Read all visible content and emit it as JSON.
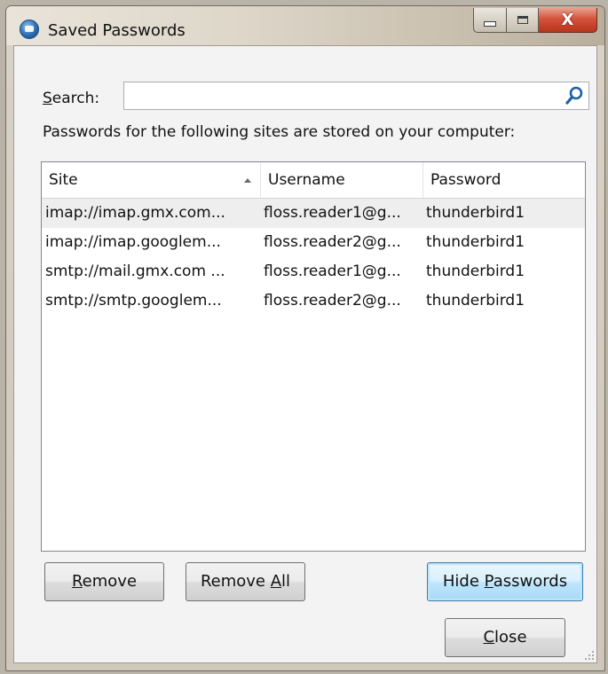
{
  "window": {
    "title": "Saved Passwords",
    "app_icon": "thunderbird-icon"
  },
  "caption_buttons": {
    "minimize": "minimize-icon",
    "maximize": "maximize-icon",
    "close_glyph": "X"
  },
  "search": {
    "label_prefix": "",
    "label_accesskey": "S",
    "label_rest": "earch:",
    "value": "",
    "placeholder": "",
    "icon": "search-icon"
  },
  "info_text": "Passwords for the following sites are stored on your computer:",
  "table": {
    "columns": {
      "site": "Site",
      "username": "Username",
      "password": "Password"
    },
    "sort_column": "Site",
    "rows": [
      {
        "site": "imap://imap.gmx.com...",
        "username": "floss.reader1@g...",
        "password": "thunderbird1"
      },
      {
        "site": "imap://imap.googlem...",
        "username": "floss.reader2@g...",
        "password": "thunderbird1"
      },
      {
        "site": "smtp://mail.gmx.com ...",
        "username": "floss.reader1@g...",
        "password": "thunderbird1"
      },
      {
        "site": "smtp://smtp.googlem...",
        "username": "floss.reader2@g...",
        "password": "thunderbird1"
      }
    ]
  },
  "buttons": {
    "remove": {
      "accesskey": "R",
      "rest": "emove"
    },
    "remove_all": {
      "prefix": "Remove ",
      "accesskey": "A",
      "rest": "ll"
    },
    "hide_passwords": {
      "prefix": "Hide ",
      "accesskey": "P",
      "rest": "asswords"
    },
    "close": {
      "accesskey": "C",
      "rest": "lose"
    }
  },
  "colors": {
    "selection": "#eeeeee",
    "default_button_border": "#3c7fb1",
    "close_button": "#c7432a"
  }
}
